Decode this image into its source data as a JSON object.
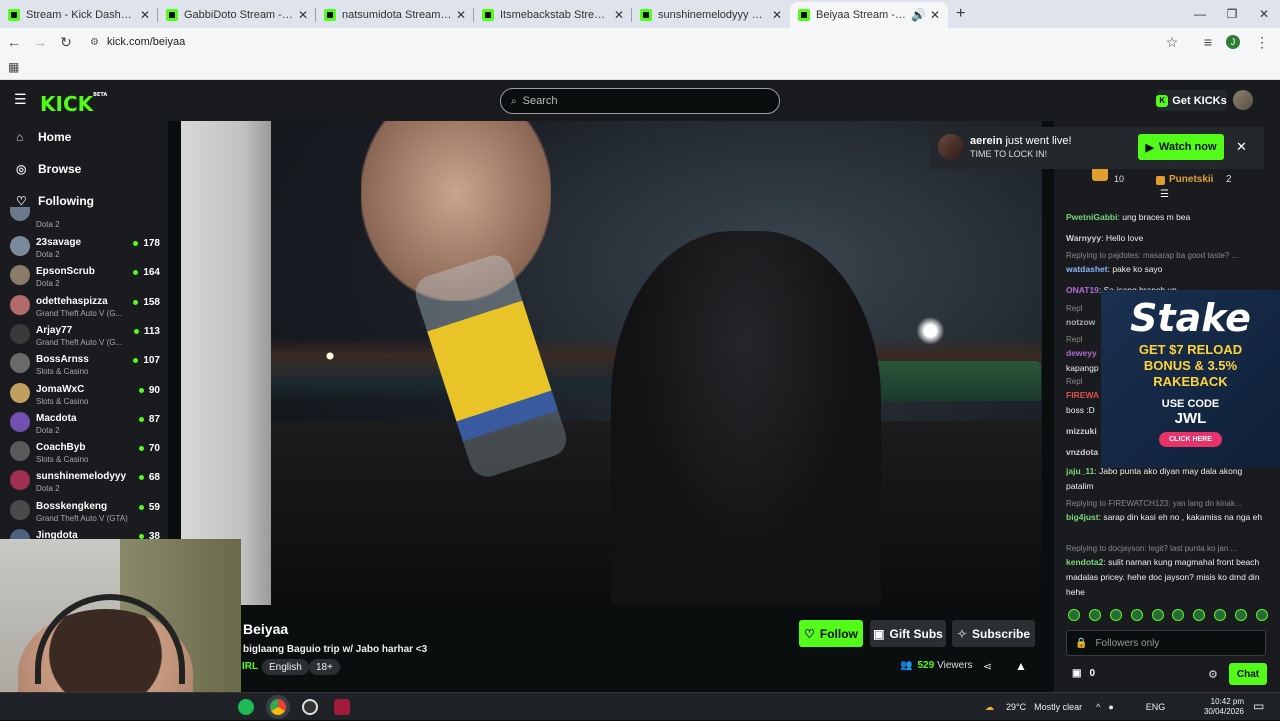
{
  "browser": {
    "tabs": [
      {
        "title": "Stream - Kick Dashboard"
      },
      {
        "title": "GabbiDoto Stream - Watch Live"
      },
      {
        "title": "natsumidota Stream - Watch Li"
      },
      {
        "title": "Itsmebackstab Stream - Watch"
      },
      {
        "title": "sunshinemelodyyy Stream - Wa"
      },
      {
        "title": "Beiyaa Stream - Watch Live"
      }
    ],
    "url": "kick.com/beiyaa",
    "profile_initial": "J"
  },
  "kick": {
    "logo": "KICK",
    "logo_badge": "BETA",
    "search_placeholder": "Search",
    "get_kicks": "Get KICKs"
  },
  "sidebar": {
    "nav": [
      {
        "label": "Home",
        "icon": "home-icon"
      },
      {
        "label": "Browse",
        "icon": "compass-icon"
      },
      {
        "label": "Following",
        "icon": "heart-icon"
      }
    ],
    "partial_category": "Dota 2",
    "channels": [
      {
        "name": "23savage",
        "category": "Dota 2",
        "viewers": "178",
        "color": "#7a8a9a"
      },
      {
        "name": "EpsonScrub",
        "category": "Dota 2",
        "viewers": "164",
        "color": "#8a7a6a"
      },
      {
        "name": "odettehaspizza",
        "category": "Grand Theft Auto V (G...",
        "viewers": "158",
        "color": "#b06a6a"
      },
      {
        "name": "Arjay77",
        "category": "Grand Theft Auto V (G...",
        "viewers": "113",
        "color": "#3a3a3a"
      },
      {
        "name": "BossArnss",
        "category": "Slots & Casino",
        "viewers": "107",
        "color": "#6a6a6a"
      },
      {
        "name": "JomaWxC",
        "category": "Slots & Casino",
        "viewers": "90",
        "color": "#c0a060"
      },
      {
        "name": "Macdota",
        "category": "Dota 2",
        "viewers": "87",
        "color": "#7050b0"
      },
      {
        "name": "CoachByb",
        "category": "Slots & Casino",
        "viewers": "70",
        "color": "#5a5a5a"
      },
      {
        "name": "sunshinemelodyyy",
        "category": "Dota 2",
        "viewers": "68",
        "color": "#a03050"
      },
      {
        "name": "Bosskengkeng",
        "category": "Grand Theft Auto V (GTA)",
        "viewers": "59",
        "color": "#4a4a4a"
      },
      {
        "name": "Jingdota",
        "category": "",
        "viewers": "38",
        "color": "#506080"
      }
    ]
  },
  "stream": {
    "streamer": "Beiyaa",
    "title": "biglaang Baguio trip w/ Jabo harhar <3",
    "category": "IRL",
    "tags": [
      "English",
      "18+"
    ],
    "follow": "Follow",
    "gift_subs": "Gift Subs",
    "subscribe": "Subscribe",
    "viewer_count": "529",
    "viewers_label": "Viewers"
  },
  "notification": {
    "user": "aerein",
    "text": "just went live!",
    "subtext": "TIME TO LOCK IN!",
    "button": "Watch now"
  },
  "chat": {
    "top_user": "Punetskii",
    "top_count": "2",
    "top_rank_count": "10",
    "messages": [
      {
        "type": "msg",
        "user": "PwetniGabbi",
        "color": "#7ad67a",
        "text": "ung braces m bea"
      },
      {
        "type": "msg",
        "user": "Warnyyy",
        "color": "#d0d0d0",
        "text": "Hello love"
      },
      {
        "type": "reply",
        "text": "Replying to pajdotes: masarap ba good taste? ..."
      },
      {
        "type": "msg",
        "user": "watdashet",
        "color": "#8ab4f8",
        "text": "pake ko sayo"
      },
      {
        "type": "msg",
        "user": "ONAT19",
        "color": "#b06ad0",
        "text": "Sa isang branch un"
      },
      {
        "type": "reply",
        "text": "Repl"
      },
      {
        "type": "msg",
        "user": "notzow",
        "color": "#aaaaaa",
        "text": ""
      },
      {
        "type": "reply",
        "text": "Repl"
      },
      {
        "type": "msg",
        "user": "deweyy",
        "color": "#b06ad0",
        "text": ""
      },
      {
        "type": "cont",
        "text": "kapangp"
      },
      {
        "type": "reply",
        "text": "Repl"
      },
      {
        "type": "msg",
        "user": "FIREWA",
        "color": "#e05050",
        "text": ""
      },
      {
        "type": "cont",
        "text": "boss :D"
      },
      {
        "type": "msg",
        "user": "mizzuki",
        "color": "#d0d0d0",
        "text": ""
      },
      {
        "type": "msg",
        "user": "vnzdota",
        "color": "#d0d0d0",
        "text": ""
      },
      {
        "type": "msg",
        "user": "jaju_11",
        "color": "#7ad67a",
        "text": "Jabo punta ako diyan may dala akong patalim"
      },
      {
        "type": "reply",
        "text": "Replying to FIREWATCH123: yan lang dn kinak..."
      },
      {
        "type": "msg",
        "user": "big4just",
        "color": "#7ad67a",
        "text": "sarap din kasi eh no , kakamiss na nga eh"
      },
      {
        "type": "reply",
        "text": "Replying to docjayson: legit? last punta ko jan ..."
      },
      {
        "type": "msg",
        "user": "kendota2",
        "color": "#7ad67a",
        "text": "sulit naman kung magmahal front beach madalas pricey. hehe doc jayson? misis ko dmd din hehe"
      }
    ],
    "input_placeholder": "Followers only",
    "gift_count": "0",
    "send": "Chat"
  },
  "ad": {
    "brand": "Stake",
    "promo": [
      "GET $7 RELOAD",
      "BONUS & 3.5%",
      "RAKEBACK"
    ],
    "use": "USE CODE",
    "code": "JWL",
    "cta": "CLICK HERE"
  },
  "taskbar": {
    "weather_temp": "29°C",
    "weather_desc": "Mostly clear",
    "lang": "ENG",
    "time": "10:42 pm",
    "date": "30/04/2026"
  }
}
